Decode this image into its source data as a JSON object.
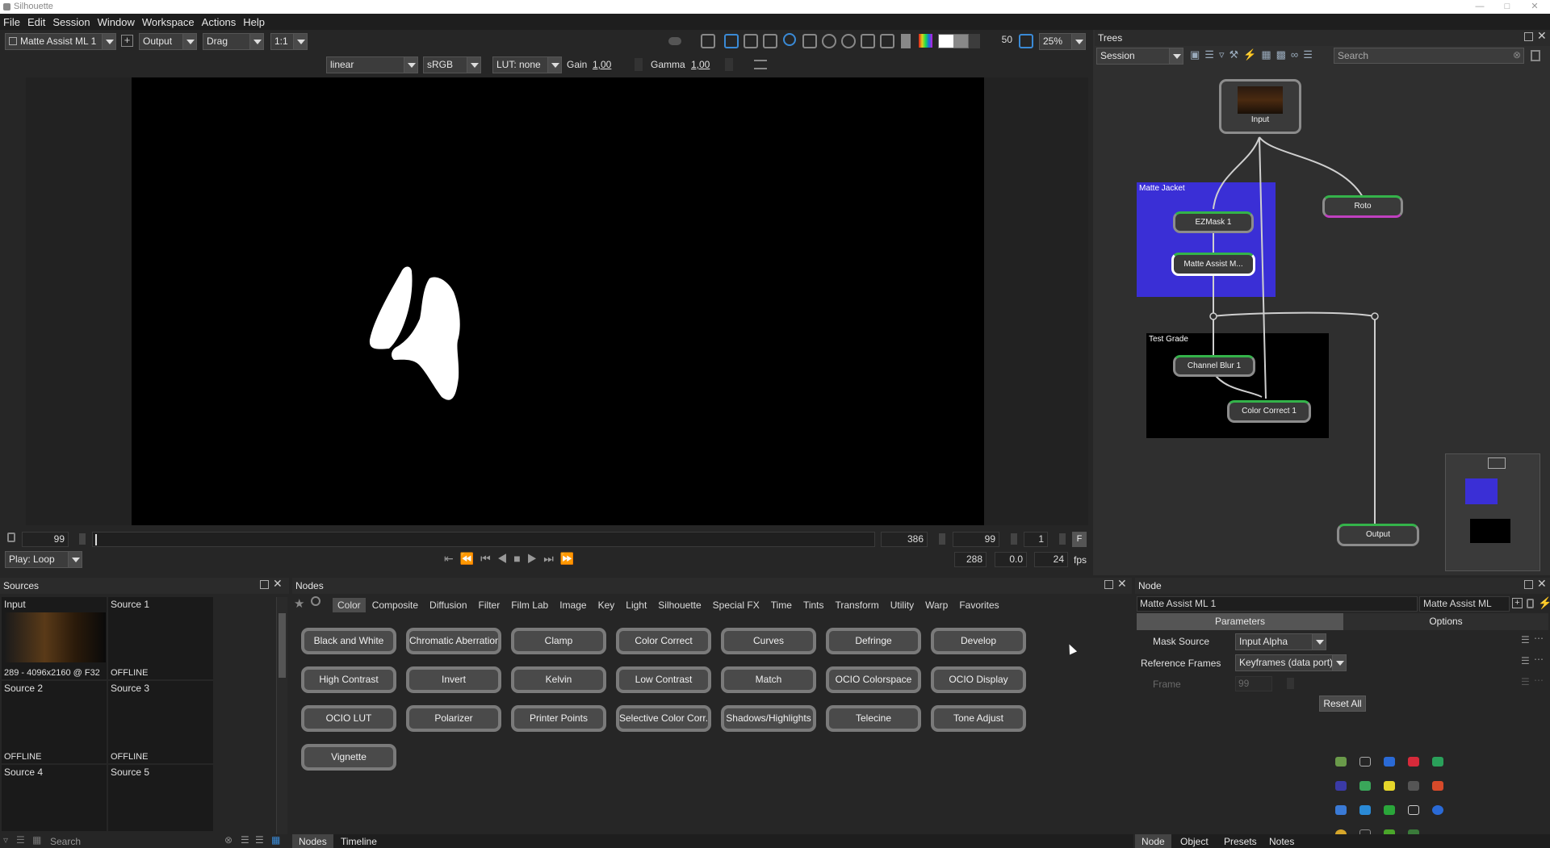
{
  "window": {
    "title": "Silhouette"
  },
  "menu": [
    "File",
    "Edit",
    "Session",
    "Window",
    "Workspace",
    "Actions",
    "Help"
  ],
  "viewer_toolbar": {
    "node_select": "Matte Assist ML 1",
    "view_mode": "Output",
    "tool_mode": "Drag",
    "pixel_ratio": "1:1",
    "exposure_value": "50",
    "zoom": "25%",
    "colorspace": "linear",
    "display": "sRGB",
    "lut": "LUT: none",
    "gain_label": "Gain",
    "gain_value": "1,00",
    "gamma_label": "Gamma",
    "gamma_value": "1,00"
  },
  "timeline": {
    "start_frame": "99",
    "end_frame": "386",
    "current_frame": "99",
    "step": "1",
    "f_button": "F",
    "play_mode": "Play: Loop",
    "duration": "288",
    "offset": "0.0",
    "fps_value": "24",
    "fps_label": "fps"
  },
  "trees": {
    "title": "Trees",
    "session": "Session",
    "search_placeholder": "Search",
    "nodes": {
      "input": "Input",
      "roto": "Roto",
      "ezmask": "EZMask 1",
      "matte_assist": "Matte Assist M...",
      "channel_blur": "Channel Blur 1",
      "color_correct": "Color Correct 1",
      "output": "Output"
    },
    "groups": {
      "matte_jacket": "Matte Jacket",
      "test_grade": "Test Grade"
    },
    "colors": {
      "matte_jacket": "#3a2fd6",
      "test_grade": "#000000"
    }
  },
  "sources": {
    "title": "Sources",
    "items": [
      {
        "name": "Input",
        "status": "289 - 4096x2160 @ F32"
      },
      {
        "name": "Source 1",
        "status": "OFFLINE"
      },
      {
        "name": "Source 2",
        "status": "OFFLINE"
      },
      {
        "name": "Source 3",
        "status": "OFFLINE"
      },
      {
        "name": "Source 4",
        "status": ""
      },
      {
        "name": "Source 5",
        "status": ""
      }
    ],
    "search_placeholder": "Search"
  },
  "nodes_panel": {
    "title": "Nodes",
    "categories": [
      "Color",
      "Composite",
      "Diffusion",
      "Filter",
      "Film Lab",
      "Image",
      "Key",
      "Light",
      "Silhouette",
      "Special FX",
      "Time",
      "Tints",
      "Transform",
      "Utility",
      "Warp",
      "Favorites"
    ],
    "active_category": "Color",
    "buttons": [
      "Black and White",
      "Chromatic Aberration",
      "Clamp",
      "Color Correct",
      "Curves",
      "Defringe",
      "Develop",
      "High Contrast",
      "Invert",
      "Kelvin",
      "Low Contrast",
      "Match",
      "OCIO Colorspace",
      "OCIO Display",
      "OCIO LUT",
      "Polarizer",
      "Printer Points",
      "Selective Color Corr...",
      "Shadows/Highlights",
      "Telecine",
      "Tone Adjust",
      "Vignette"
    ],
    "bottom_tabs": [
      "Nodes",
      "Timeline"
    ]
  },
  "node_panel": {
    "title": "Node",
    "node_name": "Matte Assist ML 1",
    "node_type": "Matte Assist ML",
    "tabs": [
      "Parameters",
      "Options"
    ],
    "params": {
      "mask_source_label": "Mask Source",
      "mask_source_value": "Input Alpha",
      "ref_frames_label": "Reference Frames",
      "ref_frames_value": "Keyframes (data port)",
      "frame_label": "Frame",
      "frame_value": "99"
    },
    "reset_label": "Reset All",
    "bottom_tabs": [
      "Node",
      "Object",
      "Presets",
      "Notes"
    ]
  },
  "colors": {
    "accent_green": "#34b34a",
    "accent_blue": "#5b5bd6",
    "panel_bg": "#262626"
  }
}
